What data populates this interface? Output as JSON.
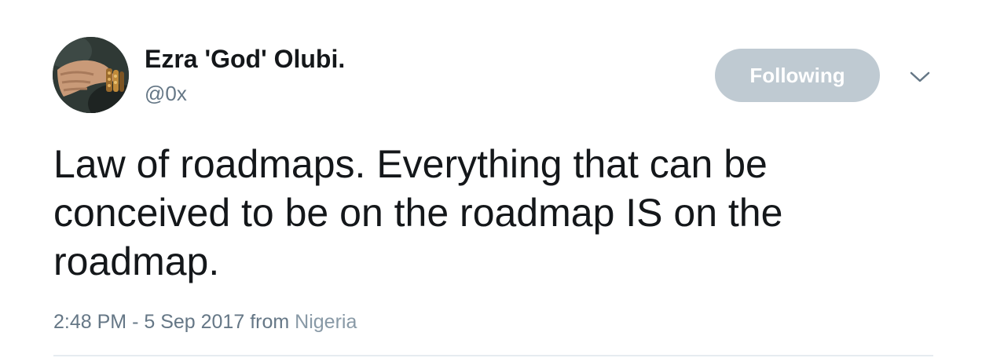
{
  "user": {
    "display_name": "Ezra 'God' Olubi.",
    "handle": "@0x"
  },
  "follow_button": {
    "label": "Following",
    "color": "#bfcad2"
  },
  "more_menu": {
    "icon": "chevron-down-icon"
  },
  "tweet": {
    "text": "Law of roadmaps. Everything that can be conceived to be on the roadmap IS on the roadmap."
  },
  "meta": {
    "time": "2:48 PM",
    "separator": "-",
    "date": "5 Sep 2017",
    "from_label": "from",
    "place": "Nigeria"
  }
}
